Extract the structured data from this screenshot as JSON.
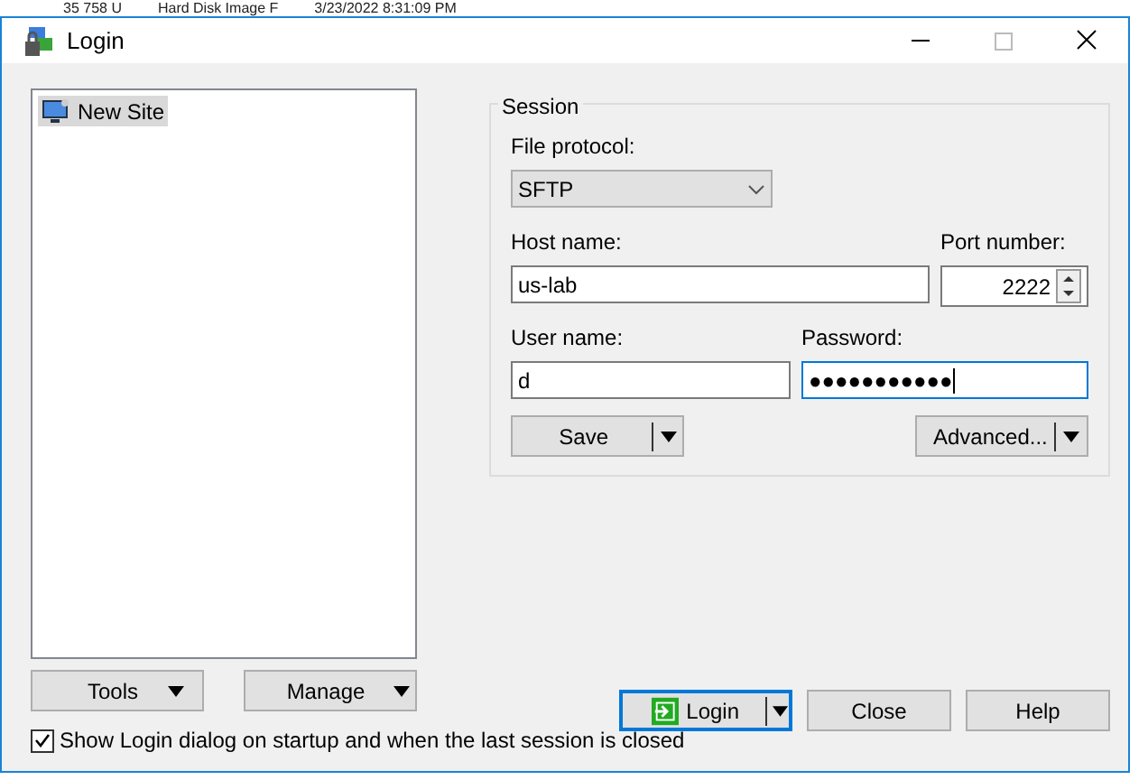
{
  "background_row": {
    "cells": [
      "35 758 U",
      "Hard Disk Image F",
      "3/23/2022 8:31:09 PM"
    ]
  },
  "window": {
    "title": "Login"
  },
  "sites": [
    {
      "label": "New Site",
      "selected": true
    }
  ],
  "session": {
    "legend": "Session",
    "file_protocol": {
      "label": "File protocol:",
      "value": "SFTP"
    },
    "host": {
      "label": "Host name:",
      "value": "us-lab"
    },
    "port": {
      "label": "Port number:",
      "value": "2222"
    },
    "user": {
      "label": "User name:",
      "value": "d"
    },
    "password": {
      "label": "Password:",
      "value": "●●●●●●●●●●●",
      "focused": true
    },
    "save_button": "Save",
    "advanced_button": "Advanced..."
  },
  "left_buttons": [
    "Tools",
    "Manage"
  ],
  "login_button": {
    "label": "Login",
    "focused": true
  },
  "buttons": [
    "Close",
    "Help"
  ],
  "startup_checkbox": {
    "label": "Show Login dialog on startup and when the last session is closed",
    "checked": true
  }
}
